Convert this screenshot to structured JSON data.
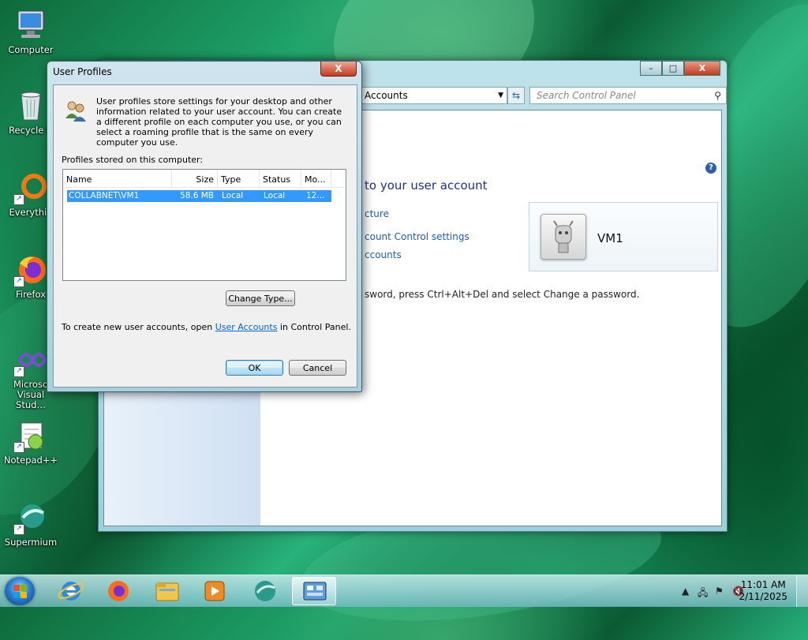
{
  "desktop": {
    "icons": [
      {
        "label": "Computer",
        "icon": "computer-icon"
      },
      {
        "label": "Recycle B",
        "icon": "recycle-bin-icon"
      },
      {
        "label": "Everythin",
        "icon": "everything-search-icon"
      },
      {
        "label": "Firefox",
        "icon": "firefox-icon"
      },
      {
        "label": "Microso\nVisual Stud…",
        "icon": "visual-studio-icon"
      },
      {
        "label": "Notepad++",
        "icon": "notepad-plus-plus-icon"
      },
      {
        "label": "Supermium",
        "icon": "supermium-icon"
      }
    ]
  },
  "control_panel": {
    "address": "Accounts",
    "search_placeholder": "Search Control Panel",
    "heading": "to your user account",
    "links": [
      "cture",
      "count Control settings",
      "ccounts"
    ],
    "password_text": "sword, press Ctrl+Alt+Del and select Change a password.",
    "account_name": "VM1",
    "help": "?",
    "buttons": {
      "minimize": "–",
      "maximize": "□",
      "close": "X"
    }
  },
  "dialog": {
    "title": "User Profiles",
    "close": "X",
    "description": "User profiles store settings for your desktop and other information related to your user account. You can create a different profile on each computer you use, or you can select a roaming profile that is the same on every computer you use.",
    "list_label": "Profiles stored on this computer:",
    "columns": [
      "Name",
      "Size",
      "Type",
      "Status",
      "Mo..."
    ],
    "rows": [
      {
        "name": "COLLABNET\\VM1",
        "size": "58.6 MB",
        "type": "Local",
        "status": "Local",
        "modified": "12..."
      }
    ],
    "change_type_label": "Change Type...",
    "note_before": "To create new user accounts, open ",
    "note_link": "User Accounts",
    "note_after": " in Control Panel.",
    "ok_label": "OK",
    "cancel_label": "Cancel"
  },
  "taskbar": {
    "items": [
      "internet-explorer-icon",
      "firefox-icon",
      "file-explorer-icon",
      "media-player-icon",
      "supermium-icon",
      "control-panel-icon"
    ],
    "time": "11:01 AM",
    "date": "2/11/2025"
  }
}
